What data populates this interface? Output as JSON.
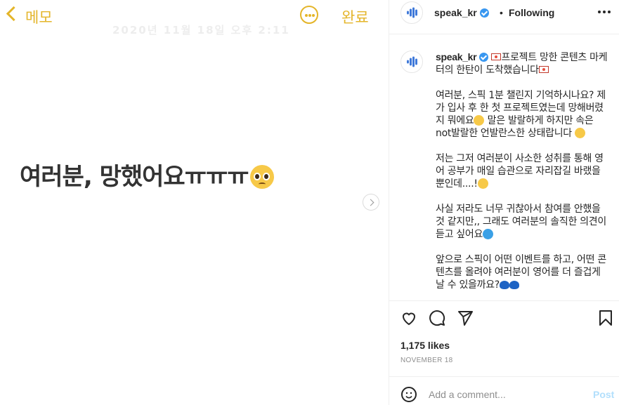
{
  "media": {
    "memo_back_label": "메모",
    "memo_done_label": "완료",
    "faded_text": "2020년 11월 18일 오후 2:11",
    "headline": "여러분, 망했어요ㅠㅠㅠ"
  },
  "header": {
    "username": "speak_kr",
    "separator": "•",
    "follow_status": "Following"
  },
  "caption": {
    "username": "speak_kr",
    "p1": "프로젝트 망한 콘텐츠 마케터의 한탄이 도착했습니다",
    "p2a": "여러분, 스픽 1분 챌린지 기억하시나요? 제가 입사 후 한 첫 프로젝트였는데 망해버렸지 뭐에요",
    "p2b": " 말은 발랄하게 하지만 속은 not발랄한 언발란스한 상태랍니다",
    "p3": "저는 그저 여러분이 사소한 성취를 통해 영어 공부가 매일 습관으로 자리잡길 바랬을 뿐인데....!",
    "p4": "사실 저라도 너무 귀찮아서 참여를 안했을 것 같지만,, 그래도 여러분의 솔직한 의견이 듣고 싶어요",
    "p5": "앞으로 스픽이 어떤 이벤트를 하고, 어떤 콘텐츠를 올려야 여러분이 영어를 더 즐겁게 날 수 있을까요?"
  },
  "engagement": {
    "likes": "1,175 likes",
    "date": "NOVEMBER 18"
  },
  "comment": {
    "placeholder": "Add a comment...",
    "post_label": "Post"
  },
  "colors": {
    "memo_accent": "#e4b52a",
    "brand_wave": "#3f79d9",
    "verified": "#3897f0",
    "post_disabled": "#b2dffc"
  }
}
